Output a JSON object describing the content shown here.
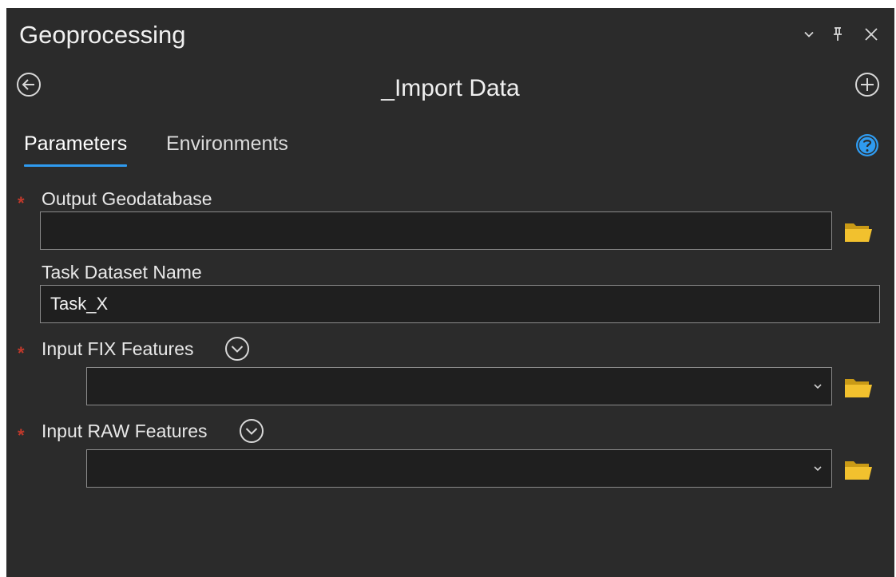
{
  "pane": {
    "title": "Geoprocessing",
    "controls": [
      "chevron-down-icon",
      "pin-icon",
      "close-icon"
    ]
  },
  "toolbar": {
    "back_icon": "back-circle-icon",
    "tool_title": "_Import Data",
    "add_icon": "add-circle-icon"
  },
  "tabs": [
    {
      "label": "Parameters",
      "active": true
    },
    {
      "label": "Environments",
      "active": false
    }
  ],
  "help_icon": "help-circle-icon",
  "required_marker": "*",
  "params": {
    "output_gdb": {
      "label": "Output Geodatabase",
      "value": "",
      "required": true
    },
    "task_name": {
      "label": "Task Dataset Name",
      "value": "Task_X",
      "required": false
    },
    "fix_features": {
      "label": "Input FIX Features",
      "value": "",
      "required": true
    },
    "raw_features": {
      "label": "Input RAW Features",
      "value": "",
      "required": true
    }
  },
  "colors": {
    "pane_bg": "#2b2b2b",
    "field_bg": "#1f1f1f",
    "accent": "#2f9bf0",
    "required": "#c0392b",
    "folder": "#f2c12e"
  }
}
